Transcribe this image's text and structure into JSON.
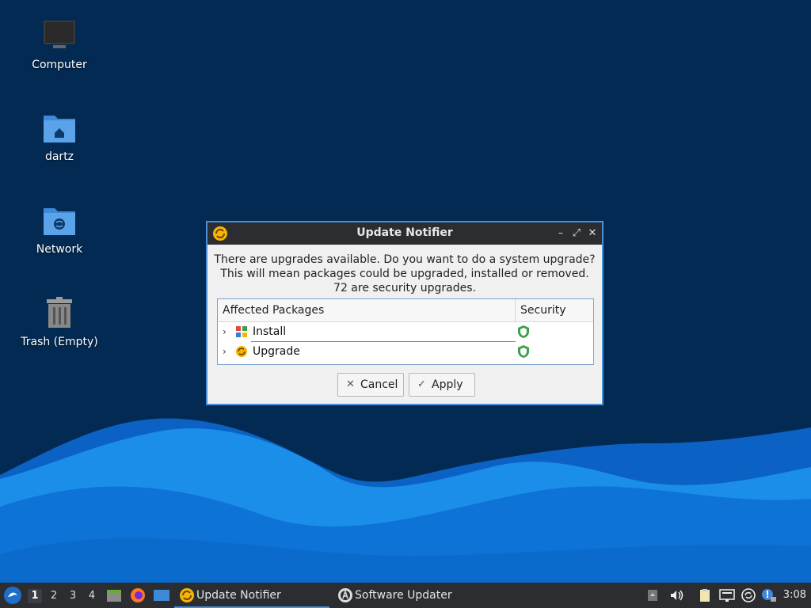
{
  "desktop": {
    "icons": [
      {
        "label": "Computer"
      },
      {
        "label": "dartz"
      },
      {
        "label": "Network"
      },
      {
        "label": "Trash (Empty)"
      }
    ]
  },
  "dialog": {
    "title": "Update Notifier",
    "message_lines": [
      "There are upgrades available. Do you want to do a system upgrade?",
      "This will mean packages could be upgraded, installed or removed.",
      "72 are security upgrades."
    ],
    "table": {
      "col_packages": "Affected Packages",
      "col_security": "Security",
      "rows": [
        {
          "label": "Install"
        },
        {
          "label": "Upgrade"
        }
      ]
    },
    "buttons": {
      "cancel": "Cancel",
      "apply": "Apply"
    }
  },
  "taskbar": {
    "workspaces": [
      "1",
      "2",
      "3",
      "4"
    ],
    "active_workspace": "1",
    "tasks": [
      {
        "label": "Update Notifier"
      },
      {
        "label": "Software Updater"
      }
    ],
    "clock": "3:08"
  },
  "colors": {
    "desktop_bg": "#032a52",
    "wave_light": "#1a8ee8",
    "wave_dark": "#0b62c4",
    "accent": "#4a8fd8",
    "panel": "#2b2d31"
  }
}
